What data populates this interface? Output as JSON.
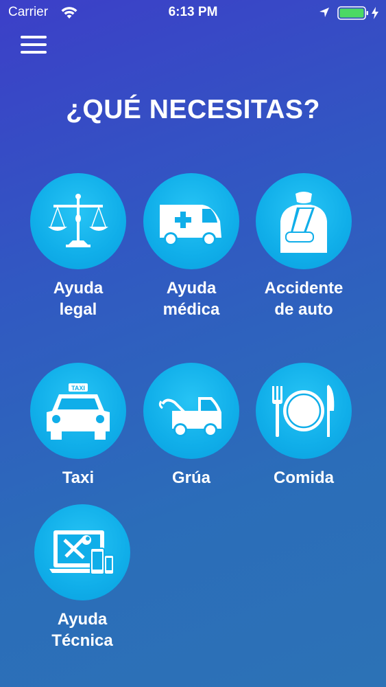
{
  "status_bar": {
    "carrier": "Carrier",
    "time": "6:13 PM",
    "battery_color": "#4cd964"
  },
  "header": {
    "menu_icon": "hamburger-menu-icon"
  },
  "title": "¿QUÉ NECESITAS?",
  "colors": {
    "background_top": "#3c3fc8",
    "background_bottom": "#2c72b6",
    "circle": "#10aee9",
    "text": "#ffffff"
  },
  "services": [
    {
      "label": "Ayuda\nlegal",
      "icon": "scales-of-justice-icon"
    },
    {
      "label": "Ayuda\nmédica",
      "icon": "ambulance-icon"
    },
    {
      "label": "Accidente\nde auto",
      "icon": "injured-person-icon"
    },
    {
      "label": "Taxi",
      "icon": "taxi-icon"
    },
    {
      "label": "Grúa",
      "icon": "tow-truck-icon"
    },
    {
      "label": "Comida",
      "icon": "plate-fork-knife-icon"
    },
    {
      "label": "Ayuda\nTécnica",
      "icon": "devices-repair-icon"
    }
  ]
}
